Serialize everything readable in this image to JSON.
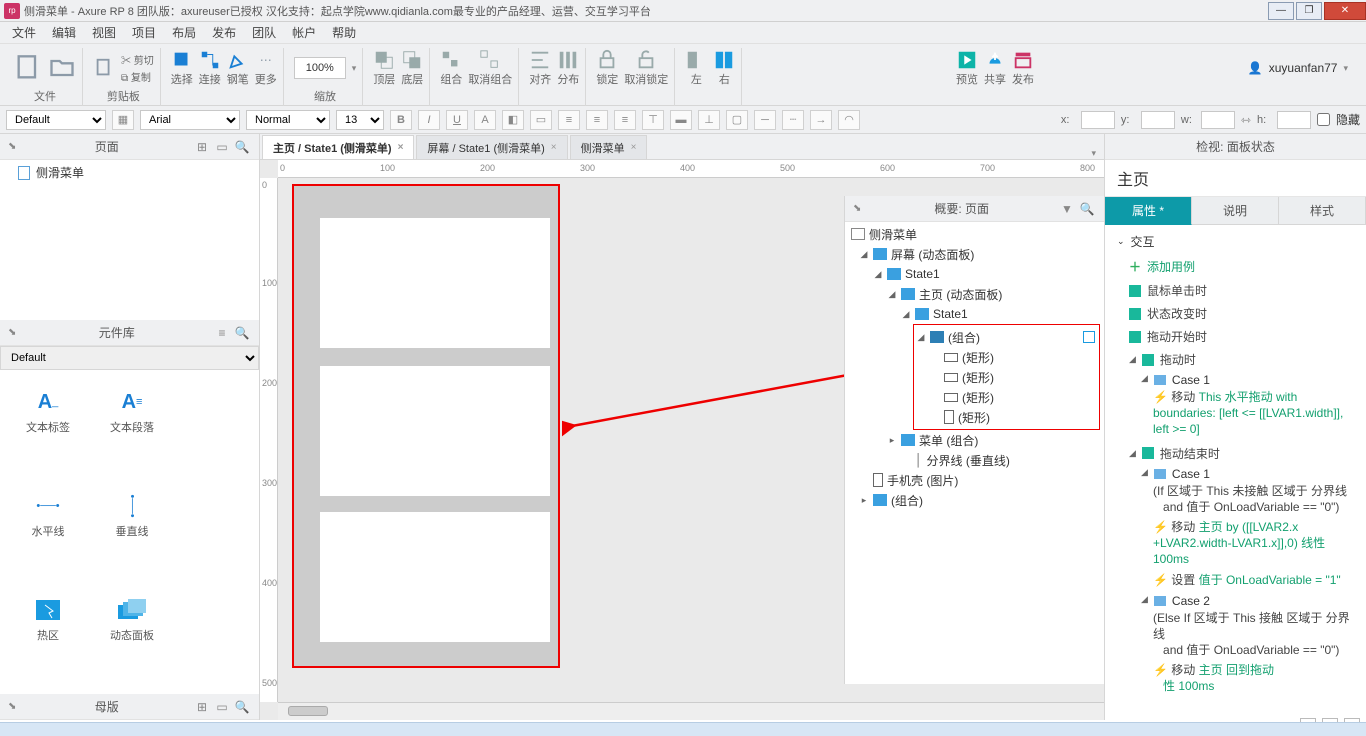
{
  "window": {
    "title": "侧滑菜单 - Axure RP 8 团队版：axureuser已授权 汉化支持：起点学院www.qidianla.com最专业的产品经理、运营、交互学习平台"
  },
  "menu": [
    "文件",
    "编辑",
    "视图",
    "项目",
    "布局",
    "发布",
    "团队",
    "帐户",
    "帮助"
  ],
  "ribbon": {
    "file": "文件",
    "clipboard": "剪贴板",
    "cut": "剪切",
    "copy": "复制",
    "select": "选择",
    "connect": "连接",
    "pen": "钢笔",
    "more": "更多",
    "zoom_value": "100%",
    "zoom_lbl": "缩放",
    "front": "顶层",
    "back": "底层",
    "group": "组合",
    "ungroup": "取消组合",
    "align": "对齐",
    "distribute": "分布",
    "lock": "锁定",
    "unlock": "取消锁定",
    "left": "左",
    "right": "右",
    "preview": "预览",
    "share": "共享",
    "publish": "发布",
    "user": "xuyuanfan77"
  },
  "fmt": {
    "style": "Default",
    "font": "Arial",
    "weight": "Normal",
    "size": "13",
    "x": "x:",
    "y": "y:",
    "w": "w:",
    "h": "h:",
    "hidden": "隐藏"
  },
  "panels": {
    "pages": "页面",
    "library": "元件库",
    "masters": "母版",
    "lib_select": "Default",
    "lib_items": [
      "文本标签",
      "文本段落",
      "水平线",
      "垂直线",
      "热区",
      "动态面板"
    ]
  },
  "pages_tree": {
    "root": "侧滑菜单"
  },
  "tabs": [
    {
      "label": "主页 / State1 (侧滑菜单)",
      "active": true
    },
    {
      "label": "屏幕 / State1 (侧滑菜单)",
      "active": false
    },
    {
      "label": "侧滑菜单",
      "active": false
    }
  ],
  "ruler_h": [
    "0",
    "100",
    "200",
    "300",
    "400",
    "500",
    "600",
    "700",
    "800"
  ],
  "ruler_v": [
    "0",
    "100",
    "200",
    "300",
    "400",
    "500"
  ],
  "outline": {
    "title": "概要: 页面",
    "root": "侧滑菜单",
    "screen": "屏幕 (动态面板)",
    "state1a": "State1",
    "home": "主页 (动态面板)",
    "state1b": "State1",
    "group1": "(组合)",
    "rects": [
      "(矩形)",
      "(矩形)",
      "(矩形)",
      "(矩形)"
    ],
    "menu": "菜单 (组合)",
    "divider": "分界线 (垂直线)",
    "phone": "手机壳 (图片)",
    "group2": "(组合)"
  },
  "inspector": {
    "head": "检视: 面板状态",
    "title": "主页",
    "tabs": [
      "属性",
      "说明",
      "样式"
    ],
    "tab_asterisk": "*",
    "interactions": "交互",
    "add_case": "添加用例",
    "events": [
      "鼠标单击时",
      "状态改变时",
      "拖动开始时"
    ],
    "drag": "拖动时",
    "drag_end": "拖动结束时",
    "case1": "Case 1",
    "case2": "Case 2",
    "act_move": "移动 ",
    "drag_text": "This 水平拖动 with boundaries: [left <= [[LVAR1.width]], left >= 0]",
    "cond1_a": "(If 区域于 This 未接触 区域于 分界线",
    "cond1_b": "and 值于 OnLoadVariable == \"0\")",
    "act1": "主页 by ([[LVAR2.x +LVAR2.width-LVAR1.x]],0) 线性 100ms",
    "set": "设置 ",
    "set1": "值于 OnLoadVariable = \"1\"",
    "cond2_a": "(Else If 区域于 This 接触 区域于 分界线",
    "cond2_b": "and 值于 OnLoadVariable == \"0\")",
    "act2a": "主页 回到拖动",
    "act2b": "性 100ms"
  }
}
